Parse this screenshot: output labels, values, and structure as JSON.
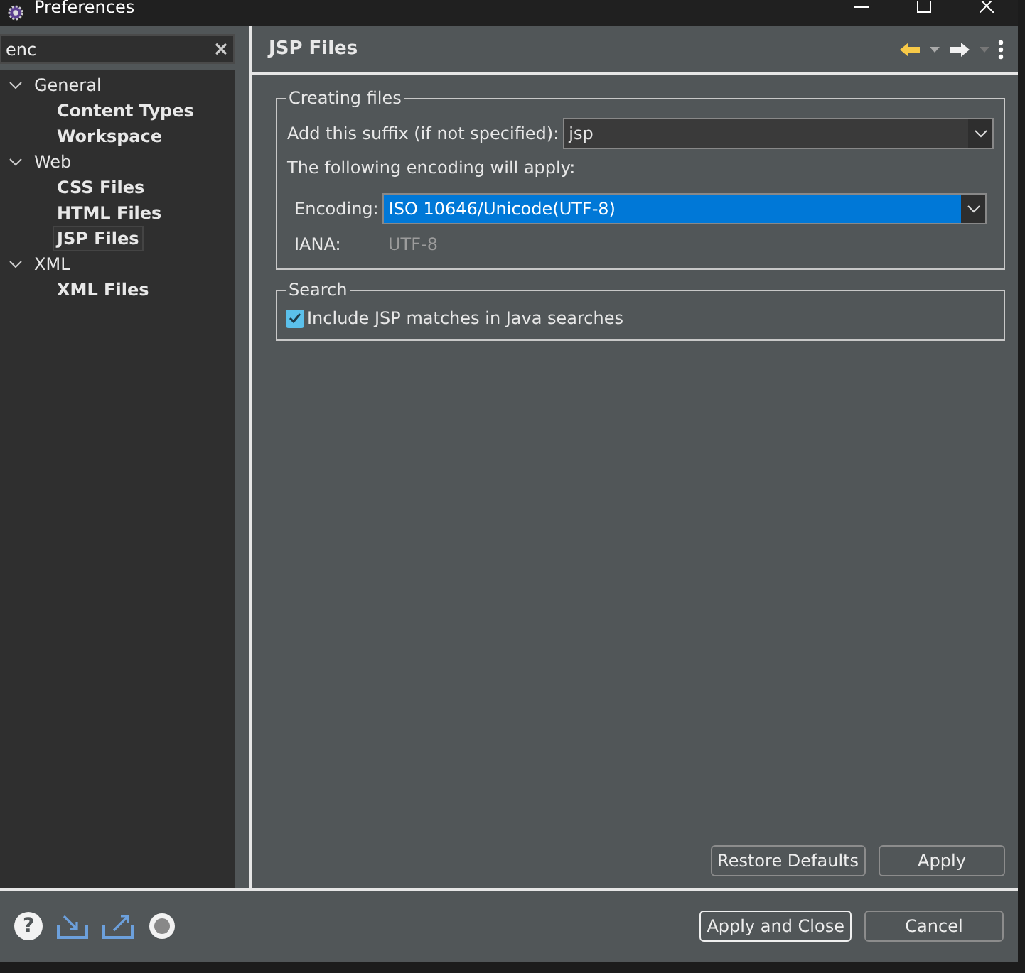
{
  "window": {
    "title": "Preferences"
  },
  "filter": {
    "value": "enc"
  },
  "footer": {
    "help_glyph": "?"
  },
  "tree": [
    {
      "label": "General",
      "expanded": true,
      "selected": false,
      "match": false,
      "children": [
        {
          "label": "Content Types",
          "selected": false,
          "match": true
        },
        {
          "label": "Workspace",
          "selected": false,
          "match": true
        }
      ]
    },
    {
      "label": "Web",
      "expanded": true,
      "selected": false,
      "match": false,
      "children": [
        {
          "label": "CSS Files",
          "selected": false,
          "match": true
        },
        {
          "label": "HTML Files",
          "selected": false,
          "match": true
        },
        {
          "label": "JSP Files",
          "selected": true,
          "match": true
        }
      ]
    },
    {
      "label": "XML",
      "expanded": true,
      "selected": false,
      "match": false,
      "children": [
        {
          "label": "XML Files",
          "selected": false,
          "match": true
        }
      ]
    }
  ],
  "page": {
    "title": "JSP Files"
  },
  "creating_files": {
    "legend": "Creating files",
    "suffix_label": "Add this suffix (if not specified):",
    "suffix_value": "jsp",
    "encoding_note": "The following encoding will apply:",
    "encoding_label": "Encoding:",
    "encoding_value": "ISO 10646/Unicode(UTF-8)",
    "encoding_highlighted": true,
    "iana_label": "IANA:",
    "iana_value": "UTF-8"
  },
  "search": {
    "legend": "Search",
    "checkbox": {
      "label": "Include JSP matches in Java searches",
      "checked": true
    }
  },
  "page_buttons": [
    "Restore Defaults",
    "Apply"
  ],
  "dialog_buttons": [
    {
      "label": "Apply and Close",
      "default": true
    },
    {
      "label": "Cancel",
      "default": false
    }
  ]
}
